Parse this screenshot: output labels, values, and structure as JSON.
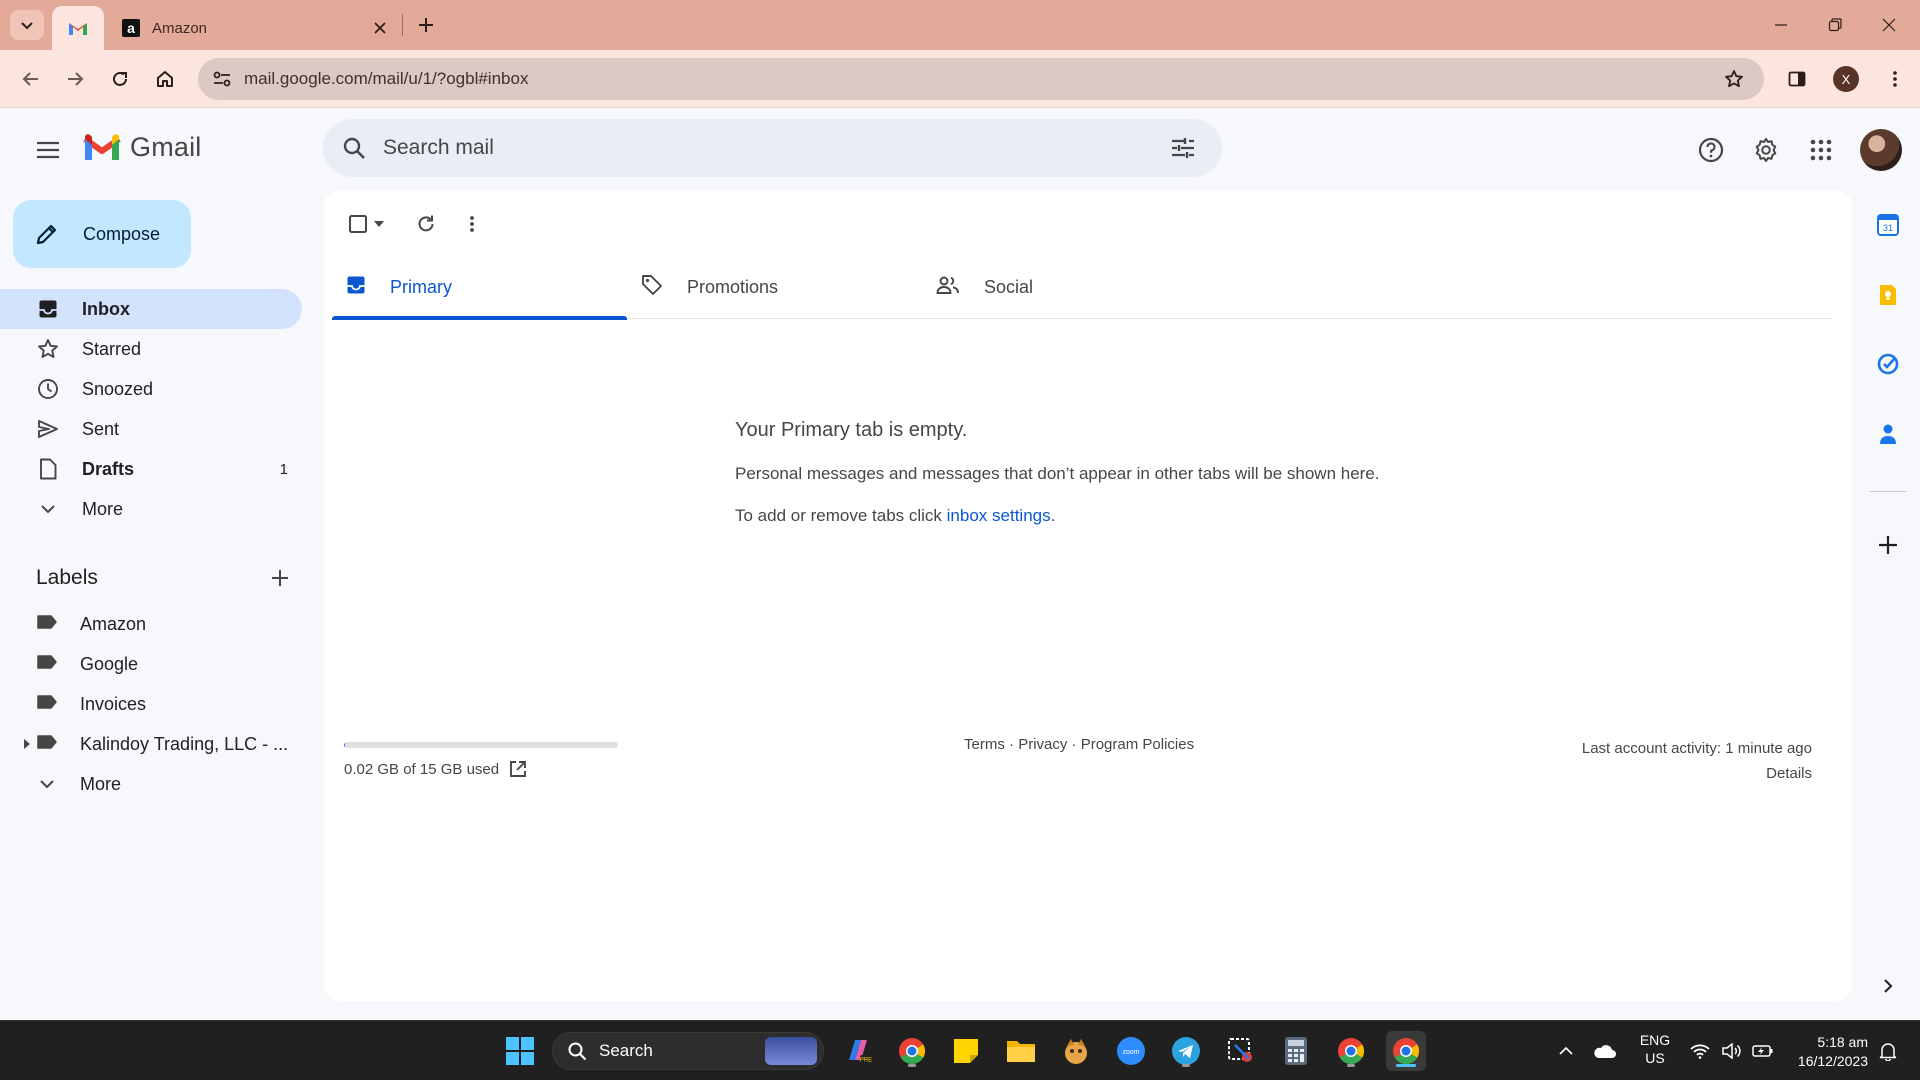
{
  "browser": {
    "tabs": [
      {
        "title": "",
        "icon": "gmail-icon",
        "active": true
      },
      {
        "title": "Amazon",
        "icon": "amazon-icon",
        "active": false
      }
    ],
    "url": "mail.google.com/mail/u/1/?ogbl#inbox",
    "profile_initial": "X"
  },
  "gmail": {
    "app_name": "Gmail",
    "search_placeholder": "Search mail",
    "compose_label": "Compose",
    "nav": [
      {
        "label": "Inbox",
        "icon": "inbox-icon",
        "count": "",
        "active": true,
        "bold": true
      },
      {
        "label": "Starred",
        "icon": "star-icon",
        "count": "",
        "active": false,
        "bold": false
      },
      {
        "label": "Snoozed",
        "icon": "clock-icon",
        "count": "",
        "active": false,
        "bold": false
      },
      {
        "label": "Sent",
        "icon": "send-icon",
        "count": "",
        "active": false,
        "bold": false
      },
      {
        "label": "Drafts",
        "icon": "draft-icon",
        "count": "1",
        "active": false,
        "bold": true
      },
      {
        "label": "More",
        "icon": "chevron-down-icon",
        "count": "",
        "active": false,
        "bold": false
      }
    ],
    "labels_title": "Labels",
    "labels": [
      {
        "label": "Amazon",
        "expandable": false
      },
      {
        "label": "Google",
        "expandable": false
      },
      {
        "label": "Invoices",
        "expandable": false
      },
      {
        "label": "Kalindoy Trading, LLC - ...",
        "expandable": true
      },
      {
        "label": "More",
        "expandable": false
      }
    ],
    "category_tabs": [
      {
        "label": "Primary",
        "icon": "inbox-icon",
        "active": true
      },
      {
        "label": "Promotions",
        "icon": "tag-icon",
        "active": false
      },
      {
        "label": "Social",
        "icon": "people-icon",
        "active": false
      }
    ],
    "empty_state": {
      "title": "Your Primary tab is empty.",
      "description": "Personal messages and messages that don’t appear in other tabs will be shown here.",
      "hint_prefix": "To add or remove tabs click ",
      "hint_link": "inbox settings",
      "hint_suffix": "."
    },
    "storage": {
      "text": "0.02 GB of 15 GB used",
      "fraction": 0.0013
    },
    "footer": {
      "terms": "Terms",
      "privacy": "Privacy",
      "policies": "Program Policies",
      "separator": " · "
    },
    "activity": {
      "line1": "Last account activity: 1 minute ago",
      "line2": "Details"
    }
  },
  "taskbar": {
    "search_label": "Search",
    "tray": {
      "lang": "ENG",
      "region": "US"
    },
    "clock": {
      "time": "5:18 am",
      "date": "16/12/2023"
    }
  },
  "colors": {
    "accent": "#0b57d0",
    "compose_bg": "#c2e7ff",
    "active_nav_bg": "#d3e3fd",
    "chrome_tabbar": "#e3a999"
  }
}
